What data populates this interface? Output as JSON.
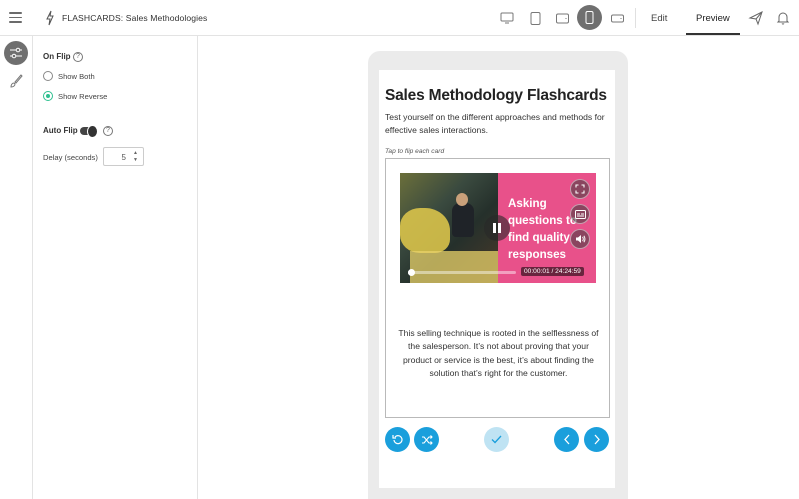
{
  "header": {
    "title": "FLASHCARDS:  Sales Methodologies",
    "tabs": [
      {
        "label": "Edit"
      },
      {
        "label": "Preview"
      }
    ]
  },
  "settings": {
    "on_flip": {
      "label": "On Flip",
      "options": [
        {
          "label": "Show Both"
        },
        {
          "label": "Show Reverse"
        }
      ]
    },
    "auto_flip": {
      "label": "Auto Flip"
    },
    "delay": {
      "label": "Delay (seconds)",
      "value": "5"
    }
  },
  "flashcards": {
    "title": "Sales Methodology Flashcards",
    "description": "Test yourself on the different approaches and methods for effective sales interactions.",
    "hint": "Tap to flip each card",
    "video": {
      "overlay_text": "Asking questions to find quality responses",
      "timecode": "00:00:01 / 24:24:59",
      "progress_fraction": 0.02
    },
    "card_text": "This selling technique is rooted in the selflessness of the salesperson. It’s not about proving that your product or service is the best, it’s about finding the solution that’s right for the customer."
  },
  "colors": {
    "accent_blue": "#1a9fdc",
    "check_disabled": "#bfe3f3",
    "radio_checked": "#2dbf8f",
    "video_pink": "#e8518a"
  },
  "icons": [
    "menu-icon",
    "lightning-icon",
    "desktop-icon",
    "tablet-icon",
    "tablet-landscape-icon",
    "phone-icon",
    "phone-landscape-icon",
    "send-icon",
    "bell-icon",
    "sliders-icon",
    "brush-icon",
    "help-icon",
    "fullscreen-icon",
    "captions-icon",
    "volume-icon",
    "pause-icon",
    "undo-icon",
    "shuffle-icon",
    "check-icon",
    "chevron-left-icon",
    "chevron-right-icon"
  ]
}
